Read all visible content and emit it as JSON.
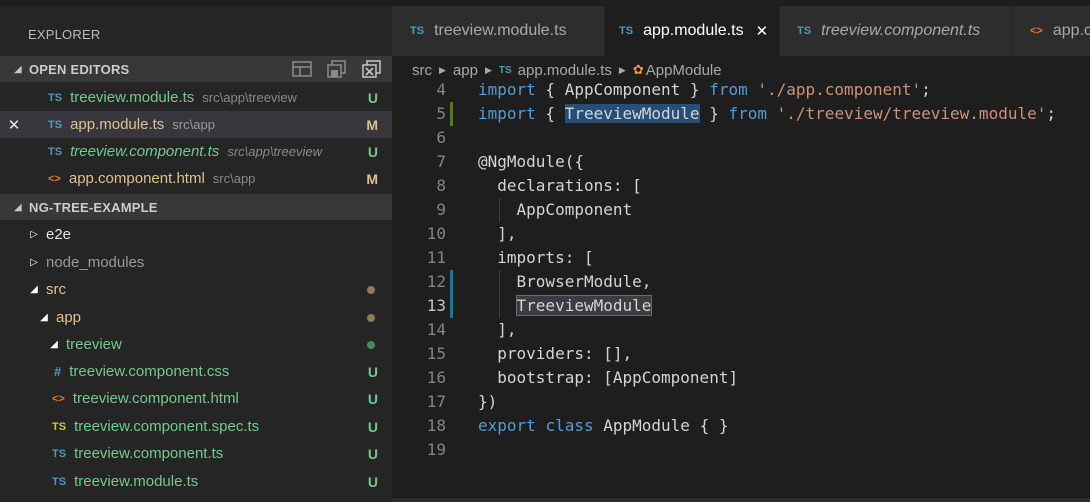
{
  "sidebar": {
    "title": "EXPLORER",
    "open_editors": {
      "label": "OPEN EDITORS",
      "items": [
        {
          "icon": "TS",
          "name": "treeview.module.ts",
          "path": "src\\app\\treeview",
          "badge": "U"
        },
        {
          "icon": "TS",
          "name": "app.module.ts",
          "path": "src\\app",
          "badge": "M",
          "close": "✕"
        },
        {
          "icon": "TS",
          "name": "treeview.component.ts",
          "path": "src\\app\\treeview",
          "badge": "U"
        },
        {
          "icon": "<>",
          "name": "app.component.html",
          "path": "src\\app",
          "badge": "M"
        }
      ]
    },
    "project": {
      "label": "NG-TREE-EXAMPLE",
      "items": [
        {
          "name": "e2e"
        },
        {
          "name": "node_modules"
        },
        {
          "name": "src"
        },
        {
          "name": "app"
        },
        {
          "name": "treeview"
        },
        {
          "icon": "#",
          "name": "treeview.component.css",
          "badge": "U"
        },
        {
          "icon": "<>",
          "name": "treeview.component.html",
          "badge": "U"
        },
        {
          "icon": "TS",
          "name": "treeview.component.spec.ts",
          "badge": "U"
        },
        {
          "icon": "TS",
          "name": "treeview.component.ts",
          "badge": "U"
        },
        {
          "icon": "TS",
          "name": "treeview.module.ts",
          "badge": "U"
        }
      ]
    }
  },
  "tabs": [
    {
      "icon": "TS",
      "label": "treeview.module.ts"
    },
    {
      "icon": "TS",
      "label": "app.module.ts",
      "close": "✕"
    },
    {
      "icon": "TS",
      "label": "treeview.component.ts"
    },
    {
      "icon": "<>",
      "label": "app.c"
    }
  ],
  "breadcrumb": {
    "parts": [
      "src",
      "app",
      "app.module.ts",
      "AppModule"
    ],
    "ts_icon": "TS",
    "class_icon": "✿"
  },
  "editor": {
    "line_numbers": [
      "4",
      "5",
      "6",
      "7",
      "8",
      "9",
      "10",
      "11",
      "12",
      "13",
      "14",
      "15",
      "16",
      "17",
      "18",
      "19"
    ],
    "lines": {
      "l4": {
        "kw1": "import",
        "t1": " { AppComponent } ",
        "kw2": "from",
        "t2": " ",
        "str": "'./app.component'",
        "t3": ";"
      },
      "l5": {
        "kw1": "import",
        "t1": " { ",
        "hl": "TreeviewModule",
        "t2": " } ",
        "kw2": "from",
        "t3": " ",
        "str": "'./treeview/treeview.module'",
        "t4": ";"
      },
      "l7": "@NgModule({",
      "l8": "  declarations: [",
      "l9": "    AppComponent",
      "l10": "  ],",
      "l11": "  imports: [",
      "l12": "    BrowserModule,",
      "l13_indent": "    ",
      "l13_hl": "TreeviewModule",
      "l14": "  ],",
      "l15": "  providers: [],",
      "l16": "  bootstrap: [AppComponent]",
      "l17": "})",
      "l18": {
        "kw1": "export",
        "t1": " ",
        "kw2": "class",
        "t2": " AppModule { }"
      }
    }
  },
  "colors": {
    "untracked": "#73c991",
    "modified": "#e2c08d",
    "keyword": "#569cd6",
    "string": "#ce9178",
    "gutter_added": "#587c0c",
    "gutter_modified": "#0c7d9d"
  }
}
